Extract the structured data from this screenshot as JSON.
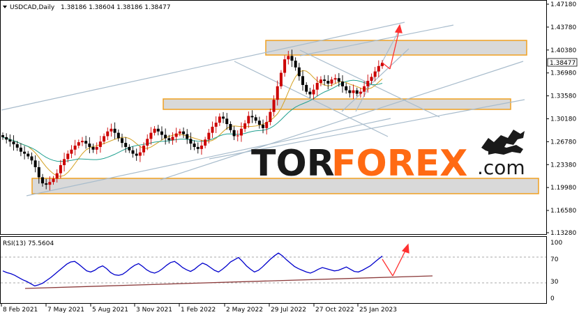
{
  "header": {
    "symbol": "USDCAD,Daily",
    "ohlc": "1.38186 1.38604 1.38186 1.38477"
  },
  "rsi_header": "RSI(13) 75.5604",
  "watermark": {
    "part1": "TOR",
    "part2": "FOREX",
    "part3": ".com",
    "icon": "bull-bear-icon"
  },
  "colors": {
    "bull": "#cc0000",
    "bear": "#000000",
    "ma_fast": "#d4a020",
    "ma_slow": "#20a090",
    "rsi": "#0000cc",
    "zone_fill": "#d9d9d9",
    "zone_border": "#f0a020",
    "arrow": "#ff3030",
    "trendline": "#a8bccc",
    "rsi_trend": "#8b3a3a",
    "wm_dark": "#1a1a1a",
    "wm_accent": "#ff6a13"
  },
  "chart_data": {
    "type": "candlestick",
    "price_axis": [
      "1.47180",
      "1.43780",
      "1.40380",
      "1.36980",
      "1.33580",
      "1.30180",
      "1.26780",
      "1.23380",
      "1.19980",
      "1.16580",
      "1.13280"
    ],
    "current_price": "1.38477",
    "ylim": [
      1.1328,
      1.4718
    ],
    "time_axis": [
      "8 Feb 2021",
      "7 May 2021",
      "5 Aug 2021",
      "3 Nov 2021",
      "1 Feb 2022",
      "2 May 2022",
      "29 Jul 2022",
      "27 Oct 2022",
      "25 Jan 2023"
    ],
    "close": [
      1.2745,
      1.271,
      1.268,
      1.264,
      1.259,
      1.253,
      1.25,
      1.246,
      1.24,
      1.23,
      1.215,
      1.206,
      1.204,
      1.208,
      1.213,
      1.221,
      1.233,
      1.242,
      1.25,
      1.256,
      1.262,
      1.267,
      1.269,
      1.265,
      1.26,
      1.256,
      1.26,
      1.268,
      1.276,
      1.283,
      1.287,
      1.281,
      1.273,
      1.266,
      1.26,
      1.255,
      1.25,
      1.247,
      1.252,
      1.262,
      1.272,
      1.281,
      1.287,
      1.283,
      1.278,
      1.273,
      1.27,
      1.275,
      1.28,
      1.283,
      1.279,
      1.272,
      1.265,
      1.26,
      1.257,
      1.262,
      1.271,
      1.281,
      1.29,
      1.296,
      1.305,
      1.302,
      1.294,
      1.285,
      1.276,
      1.277,
      1.287,
      1.295,
      1.306,
      1.304,
      1.299,
      1.293,
      1.288,
      1.297,
      1.312,
      1.33,
      1.35,
      1.37,
      1.39,
      1.395,
      1.388,
      1.378,
      1.365,
      1.352,
      1.342,
      1.338,
      1.345,
      1.355,
      1.36,
      1.358,
      1.354,
      1.36,
      1.362,
      1.357,
      1.35,
      1.344,
      1.34,
      1.344,
      1.339,
      1.342,
      1.35,
      1.358,
      1.364,
      1.372,
      1.38,
      1.3848
    ],
    "rsi_data": {
      "title": "RSI(13)",
      "value": "75.5604",
      "axis": [
        "100",
        "70",
        "30",
        "0"
      ],
      "levels": [
        70,
        30
      ],
      "ylim": [
        0,
        100
      ],
      "values": [
        49,
        46,
        44,
        41,
        37,
        33,
        30,
        26,
        22,
        24,
        27,
        32,
        37,
        43,
        49,
        55,
        61,
        65,
        66,
        61,
        55,
        49,
        47,
        50,
        55,
        58,
        53,
        46,
        42,
        41,
        43,
        48,
        54,
        59,
        62,
        57,
        51,
        47,
        45,
        48,
        53,
        59,
        64,
        66,
        61,
        55,
        51,
        48,
        52,
        58,
        63,
        60,
        55,
        50,
        47,
        52,
        58,
        65,
        69,
        73,
        66,
        58,
        52,
        47,
        50,
        56,
        63,
        70,
        76,
        81,
        76,
        69,
        63,
        57,
        53,
        50,
        47,
        45,
        48,
        52,
        55,
        53,
        51,
        49,
        50,
        53,
        56,
        52,
        48,
        47,
        50,
        54,
        58,
        64,
        70,
        75.56
      ]
    }
  }
}
